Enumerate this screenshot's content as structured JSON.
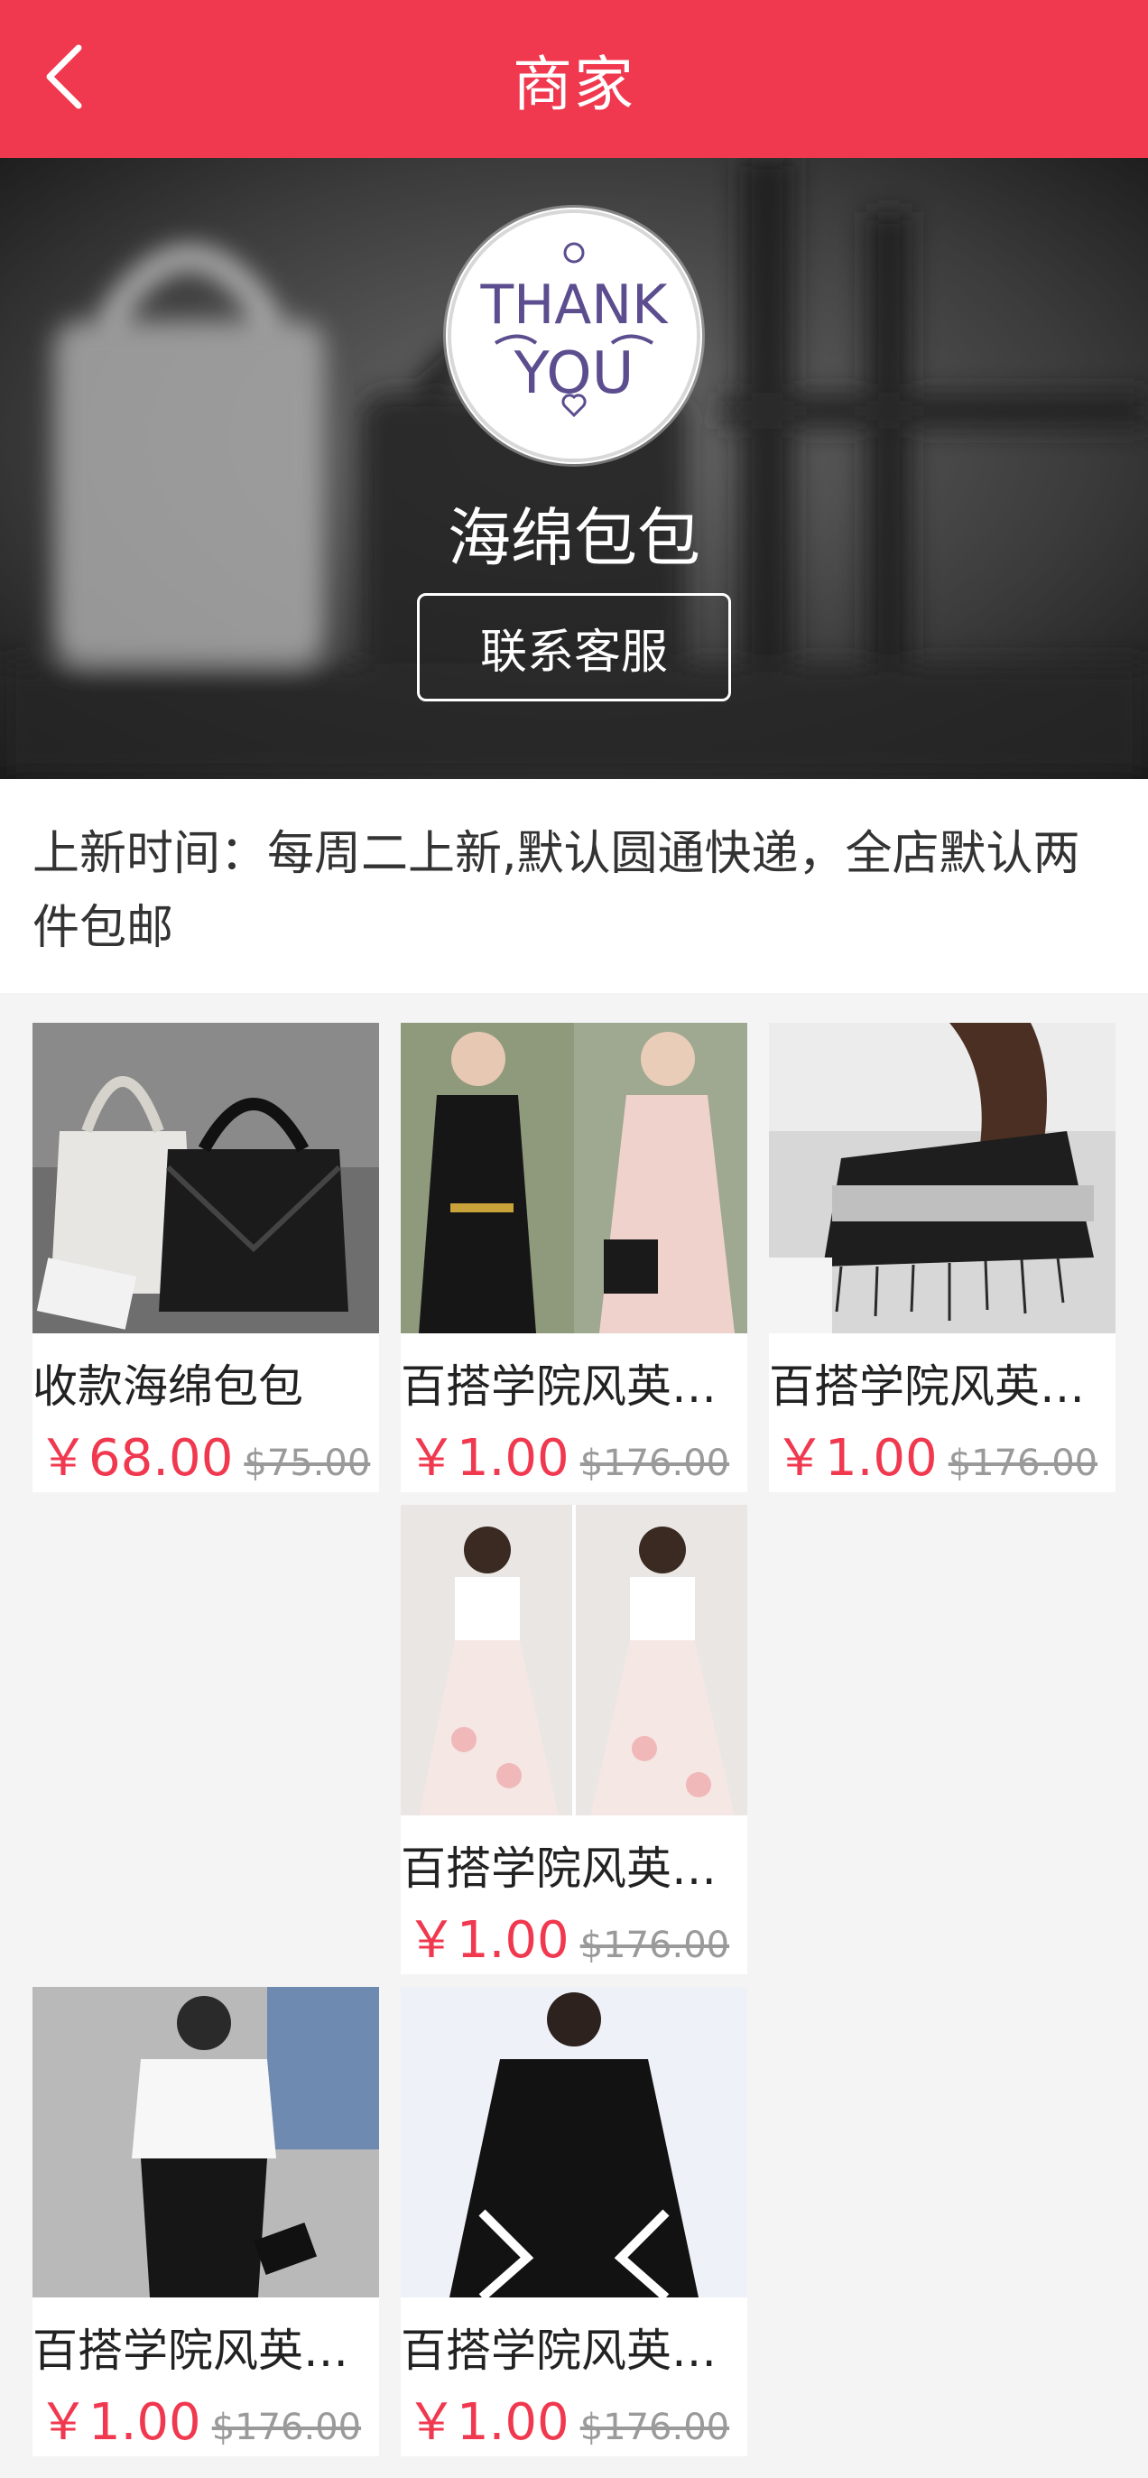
{
  "header": {
    "title": "商家",
    "back_icon": "chevron-left-icon"
  },
  "shop": {
    "name": "海绵包包",
    "contact_label": "联系客服",
    "avatar_text_line1": "THANK",
    "avatar_text_line2": "YOU"
  },
  "notice": {
    "text": "上新时间：每周二上新,默认圆通快递，全店默认两件包邮"
  },
  "products": [
    {
      "name": "收款海绵包包",
      "price": "￥68.00",
      "old_price": "$75.00"
    },
    {
      "name": "百搭学院风英伦风小皮鞋",
      "price": "￥1.00",
      "old_price": "$176.00"
    },
    {
      "name": "百搭学院风英伦风小皮鞋",
      "price": "￥1.00",
      "old_price": "$176.00"
    },
    {
      "name": "百搭学院风英伦风小皮鞋",
      "price": "￥1.00",
      "old_price": "$176.00"
    },
    {
      "name": "百搭学院风英伦风小皮鞋",
      "price": "￥1.00",
      "old_price": "$176.00"
    },
    {
      "name": "百搭学院风英伦风小皮鞋",
      "price": "￥1.00",
      "old_price": "$176.00"
    }
  ],
  "colors": {
    "accent": "#f0384f",
    "old_price": "#9a9a9a",
    "background": "#f4f4f4"
  }
}
